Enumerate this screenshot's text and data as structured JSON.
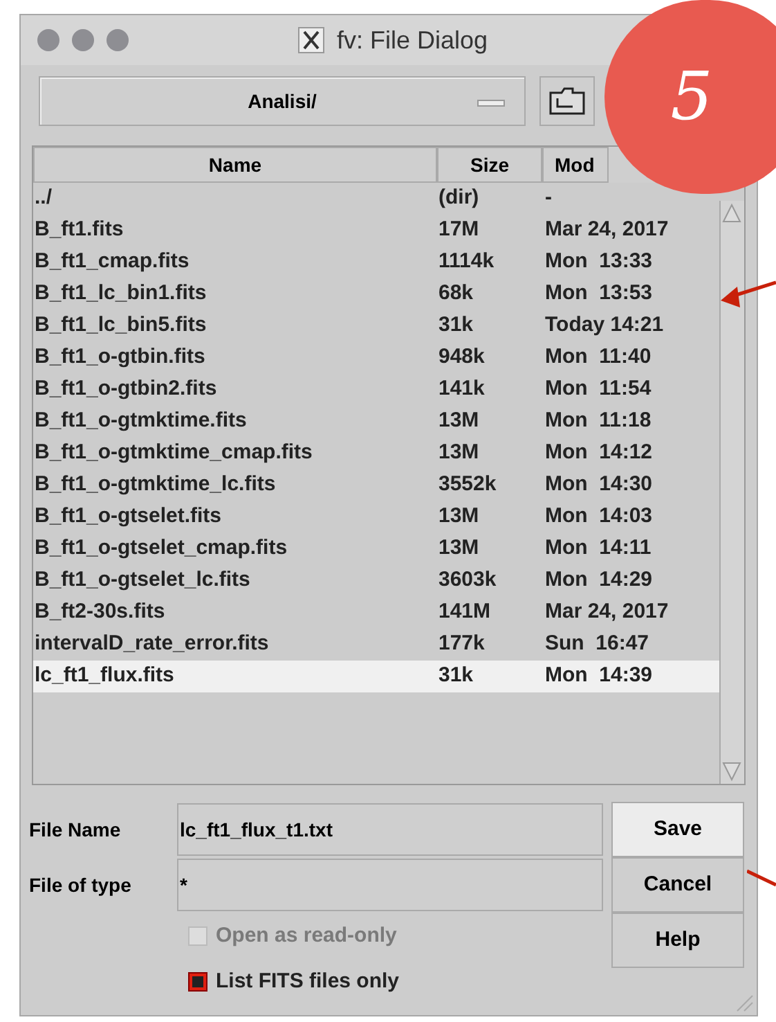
{
  "window": {
    "title": "fv: File Dialog"
  },
  "folder": {
    "value": "Analisi/"
  },
  "table": {
    "columns": [
      "Name",
      "Size",
      "Mod"
    ],
    "rows": [
      {
        "name": "../",
        "size": "(dir)",
        "date": "-",
        "selected": false
      },
      {
        "name": "B_ft1.fits",
        "size": "17M",
        "date": "Mar 24, 2017",
        "selected": false
      },
      {
        "name": "B_ft1_cmap.fits",
        "size": "1114k",
        "date": "Mon  13:33",
        "selected": false
      },
      {
        "name": "B_ft1_lc_bin1.fits",
        "size": "68k",
        "date": "Mon  13:53",
        "selected": false
      },
      {
        "name": "B_ft1_lc_bin5.fits",
        "size": "31k",
        "date": "Today 14:21",
        "selected": false
      },
      {
        "name": "B_ft1_o-gtbin.fits",
        "size": "948k",
        "date": "Mon  11:40",
        "selected": false
      },
      {
        "name": "B_ft1_o-gtbin2.fits",
        "size": "141k",
        "date": "Mon  11:54",
        "selected": false
      },
      {
        "name": "B_ft1_o-gtmktime.fits",
        "size": "13M",
        "date": "Mon  11:18",
        "selected": false
      },
      {
        "name": "B_ft1_o-gtmktime_cmap.fits",
        "size": "13M",
        "date": "Mon  14:12",
        "selected": false
      },
      {
        "name": "B_ft1_o-gtmktime_lc.fits",
        "size": "3552k",
        "date": "Mon  14:30",
        "selected": false
      },
      {
        "name": "B_ft1_o-gtselet.fits",
        "size": "13M",
        "date": "Mon  14:03",
        "selected": false
      },
      {
        "name": "B_ft1_o-gtselet_cmap.fits",
        "size": "13M",
        "date": "Mon  14:11",
        "selected": false
      },
      {
        "name": "B_ft1_o-gtselet_lc.fits",
        "size": "3603k",
        "date": "Mon  14:29",
        "selected": false
      },
      {
        "name": "B_ft2-30s.fits",
        "size": "141M",
        "date": "Mar 24, 2017",
        "selected": false
      },
      {
        "name": "intervalD_rate_error.fits",
        "size": "177k",
        "date": "Sun  16:47",
        "selected": false
      },
      {
        "name": "lc_ft1_flux.fits",
        "size": "31k",
        "date": "Mon  14:39",
        "selected": true
      }
    ]
  },
  "fields": [
    {
      "label": "File Name",
      "value": "lc_ft1_flux_t1.txt"
    },
    {
      "label": "File of type",
      "value": "*"
    }
  ],
  "buttons": [
    {
      "label": "Save",
      "selected": true
    },
    {
      "label": "Cancel",
      "selected": false
    },
    {
      "label": "Help",
      "selected": false
    }
  ],
  "options": [
    {
      "label": "Open as read-only",
      "checked": false,
      "disabled": true
    },
    {
      "label": "List FITS files only",
      "checked": true,
      "disabled": false
    }
  ],
  "annotation": {
    "badge": "5"
  }
}
